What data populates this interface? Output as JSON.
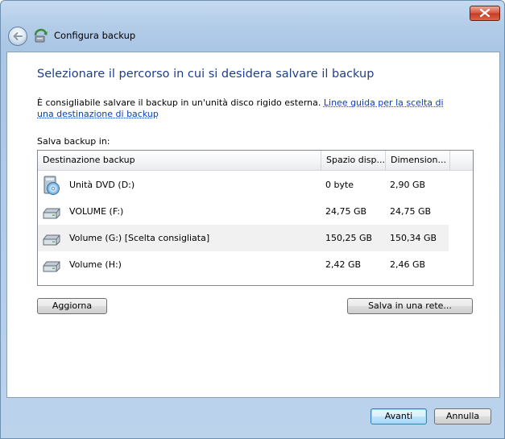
{
  "window": {
    "title": "Configura backup"
  },
  "heading": "Selezionare il percorso in cui si desidera salvare il backup",
  "description": {
    "text": "È consigliabile salvare il backup in un'unità disco rigido esterna. ",
    "link": "Linee guida per la scelta di una destinazione di backup"
  },
  "save_label": "Salva backup in:",
  "list": {
    "columns": [
      "Destinazione backup",
      "Spazio disp...",
      "Dimension..."
    ],
    "rows": [
      {
        "name": "Unità DVD (D:)",
        "free": "0 byte",
        "size": "2,90 GB",
        "icon": "dvd-drive-icon"
      },
      {
        "name": "VOLUME (F:)",
        "free": "24,75 GB",
        "size": "24,75 GB",
        "icon": "hard-drive-icon"
      },
      {
        "name": "Volume (G:) [Scelta consigliata]",
        "free": "150,25 GB",
        "size": "150,34 GB",
        "icon": "hard-drive-icon"
      },
      {
        "name": "Volume (H:)",
        "free": "2,42 GB",
        "size": "2,46 GB",
        "icon": "hard-drive-icon"
      }
    ]
  },
  "buttons": {
    "refresh": "Aggiorna",
    "network": "Salva in una rete...",
    "next": "Avanti",
    "cancel": "Annulla"
  }
}
